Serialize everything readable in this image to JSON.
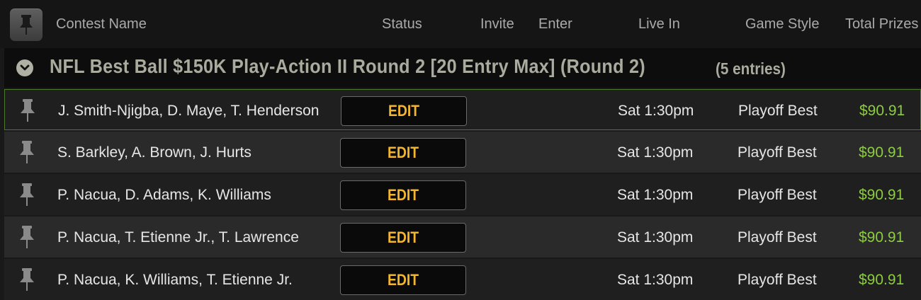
{
  "header": {
    "columns": {
      "contest_name": "Contest Name",
      "status": "Status",
      "invite": "Invite",
      "enter": "Enter",
      "live_in": "Live In",
      "game_style": "Game Style",
      "total_prizes": "Total Prizes"
    },
    "pin_icon": "pushpin-icon"
  },
  "group": {
    "title": "NFL Best Ball $150K Play-Action II Round 2 [20 Entry Max] (Round 2)",
    "entries": "(5 entries)",
    "expand_icon": "chevron-down-icon"
  },
  "rows": [
    {
      "name": "J. Smith-Njigba, D. Maye, T. Henderson",
      "button": "EDIT",
      "live_in": "Sat 1:30pm",
      "game_style": "Playoff Best",
      "prize": "$90.91",
      "selected": true
    },
    {
      "name": "S. Barkley, A. Brown, J. Hurts",
      "button": "EDIT",
      "live_in": "Sat 1:30pm",
      "game_style": "Playoff Best",
      "prize": "$90.91"
    },
    {
      "name": "P. Nacua, D. Adams, K. Williams",
      "button": "EDIT",
      "live_in": "Sat 1:30pm",
      "game_style": "Playoff Best",
      "prize": "$90.91"
    },
    {
      "name": "P. Nacua, T. Etienne Jr., T. Lawrence",
      "button": "EDIT",
      "live_in": "Sat 1:30pm",
      "game_style": "Playoff Best",
      "prize": "$90.91"
    },
    {
      "name": "P. Nacua, K. Williams, T. Etienne Jr.",
      "button": "EDIT",
      "live_in": "Sat 1:30pm",
      "game_style": "Playoff Best",
      "prize": "$90.91"
    }
  ],
  "colors": {
    "accent_button_text": "#f2b52e",
    "prize_green": "#8ccd3f",
    "selected_border": "#4f7a2b"
  }
}
